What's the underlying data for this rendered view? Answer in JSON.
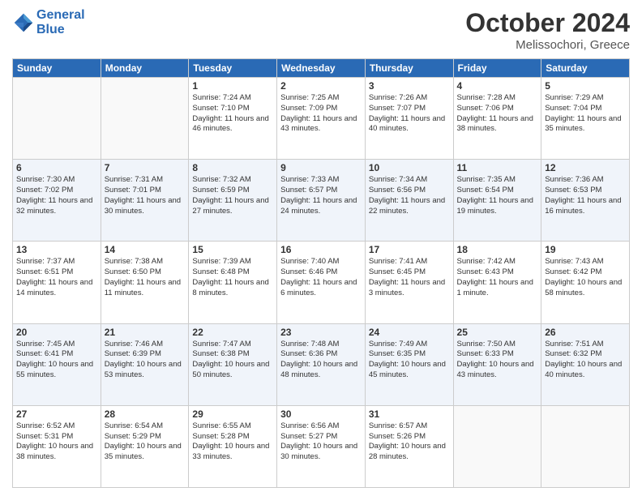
{
  "header": {
    "logo_line1": "General",
    "logo_line2": "Blue",
    "month": "October 2024",
    "location": "Melissochori, Greece"
  },
  "days_of_week": [
    "Sunday",
    "Monday",
    "Tuesday",
    "Wednesday",
    "Thursday",
    "Friday",
    "Saturday"
  ],
  "weeks": [
    [
      {
        "day": "",
        "info": ""
      },
      {
        "day": "",
        "info": ""
      },
      {
        "day": "1",
        "info": "Sunrise: 7:24 AM\nSunset: 7:10 PM\nDaylight: 11 hours and 46 minutes."
      },
      {
        "day": "2",
        "info": "Sunrise: 7:25 AM\nSunset: 7:09 PM\nDaylight: 11 hours and 43 minutes."
      },
      {
        "day": "3",
        "info": "Sunrise: 7:26 AM\nSunset: 7:07 PM\nDaylight: 11 hours and 40 minutes."
      },
      {
        "day": "4",
        "info": "Sunrise: 7:28 AM\nSunset: 7:06 PM\nDaylight: 11 hours and 38 minutes."
      },
      {
        "day": "5",
        "info": "Sunrise: 7:29 AM\nSunset: 7:04 PM\nDaylight: 11 hours and 35 minutes."
      }
    ],
    [
      {
        "day": "6",
        "info": "Sunrise: 7:30 AM\nSunset: 7:02 PM\nDaylight: 11 hours and 32 minutes."
      },
      {
        "day": "7",
        "info": "Sunrise: 7:31 AM\nSunset: 7:01 PM\nDaylight: 11 hours and 30 minutes."
      },
      {
        "day": "8",
        "info": "Sunrise: 7:32 AM\nSunset: 6:59 PM\nDaylight: 11 hours and 27 minutes."
      },
      {
        "day": "9",
        "info": "Sunrise: 7:33 AM\nSunset: 6:57 PM\nDaylight: 11 hours and 24 minutes."
      },
      {
        "day": "10",
        "info": "Sunrise: 7:34 AM\nSunset: 6:56 PM\nDaylight: 11 hours and 22 minutes."
      },
      {
        "day": "11",
        "info": "Sunrise: 7:35 AM\nSunset: 6:54 PM\nDaylight: 11 hours and 19 minutes."
      },
      {
        "day": "12",
        "info": "Sunrise: 7:36 AM\nSunset: 6:53 PM\nDaylight: 11 hours and 16 minutes."
      }
    ],
    [
      {
        "day": "13",
        "info": "Sunrise: 7:37 AM\nSunset: 6:51 PM\nDaylight: 11 hours and 14 minutes."
      },
      {
        "day": "14",
        "info": "Sunrise: 7:38 AM\nSunset: 6:50 PM\nDaylight: 11 hours and 11 minutes."
      },
      {
        "day": "15",
        "info": "Sunrise: 7:39 AM\nSunset: 6:48 PM\nDaylight: 11 hours and 8 minutes."
      },
      {
        "day": "16",
        "info": "Sunrise: 7:40 AM\nSunset: 6:46 PM\nDaylight: 11 hours and 6 minutes."
      },
      {
        "day": "17",
        "info": "Sunrise: 7:41 AM\nSunset: 6:45 PM\nDaylight: 11 hours and 3 minutes."
      },
      {
        "day": "18",
        "info": "Sunrise: 7:42 AM\nSunset: 6:43 PM\nDaylight: 11 hours and 1 minute."
      },
      {
        "day": "19",
        "info": "Sunrise: 7:43 AM\nSunset: 6:42 PM\nDaylight: 10 hours and 58 minutes."
      }
    ],
    [
      {
        "day": "20",
        "info": "Sunrise: 7:45 AM\nSunset: 6:41 PM\nDaylight: 10 hours and 55 minutes."
      },
      {
        "day": "21",
        "info": "Sunrise: 7:46 AM\nSunset: 6:39 PM\nDaylight: 10 hours and 53 minutes."
      },
      {
        "day": "22",
        "info": "Sunrise: 7:47 AM\nSunset: 6:38 PM\nDaylight: 10 hours and 50 minutes."
      },
      {
        "day": "23",
        "info": "Sunrise: 7:48 AM\nSunset: 6:36 PM\nDaylight: 10 hours and 48 minutes."
      },
      {
        "day": "24",
        "info": "Sunrise: 7:49 AM\nSunset: 6:35 PM\nDaylight: 10 hours and 45 minutes."
      },
      {
        "day": "25",
        "info": "Sunrise: 7:50 AM\nSunset: 6:33 PM\nDaylight: 10 hours and 43 minutes."
      },
      {
        "day": "26",
        "info": "Sunrise: 7:51 AM\nSunset: 6:32 PM\nDaylight: 10 hours and 40 minutes."
      }
    ],
    [
      {
        "day": "27",
        "info": "Sunrise: 6:52 AM\nSunset: 5:31 PM\nDaylight: 10 hours and 38 minutes."
      },
      {
        "day": "28",
        "info": "Sunrise: 6:54 AM\nSunset: 5:29 PM\nDaylight: 10 hours and 35 minutes."
      },
      {
        "day": "29",
        "info": "Sunrise: 6:55 AM\nSunset: 5:28 PM\nDaylight: 10 hours and 33 minutes."
      },
      {
        "day": "30",
        "info": "Sunrise: 6:56 AM\nSunset: 5:27 PM\nDaylight: 10 hours and 30 minutes."
      },
      {
        "day": "31",
        "info": "Sunrise: 6:57 AM\nSunset: 5:26 PM\nDaylight: 10 hours and 28 minutes."
      },
      {
        "day": "",
        "info": ""
      },
      {
        "day": "",
        "info": ""
      }
    ]
  ]
}
